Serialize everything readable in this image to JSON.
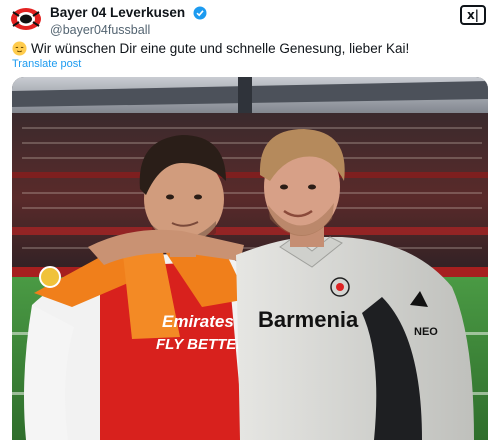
{
  "account": {
    "display_name": "Bayer 04 Leverkusen",
    "handle": "@bayer04fussball",
    "avatar_icon": "bayer-crest-icon",
    "verified_icon": "verified-badge-icon"
  },
  "grok_button": {
    "label": "x|",
    "icon": "grok-icon"
  },
  "tweet": {
    "emoji_icon": "relieved-face-emoji",
    "text": "Wir wünschen Dir eine gute und schnelle Genesung, lieber Kai!",
    "translate_label": "Translate post"
  },
  "media": {
    "shirt_left_sponsor_line1": "Emirates",
    "shirt_left_sponsor_line2": "FLY BETTER",
    "shirt_right_sponsor": "Barmenia",
    "shirt_right_sleeve_text": "NEO"
  },
  "colors": {
    "link": "#1d9bf0",
    "verified": "#1d9bf0",
    "secondary_text": "#536471",
    "arsenal_red": "#d8211d",
    "scarf_orange": "#f07f1b",
    "pitch_green": "#3f8a3a"
  }
}
